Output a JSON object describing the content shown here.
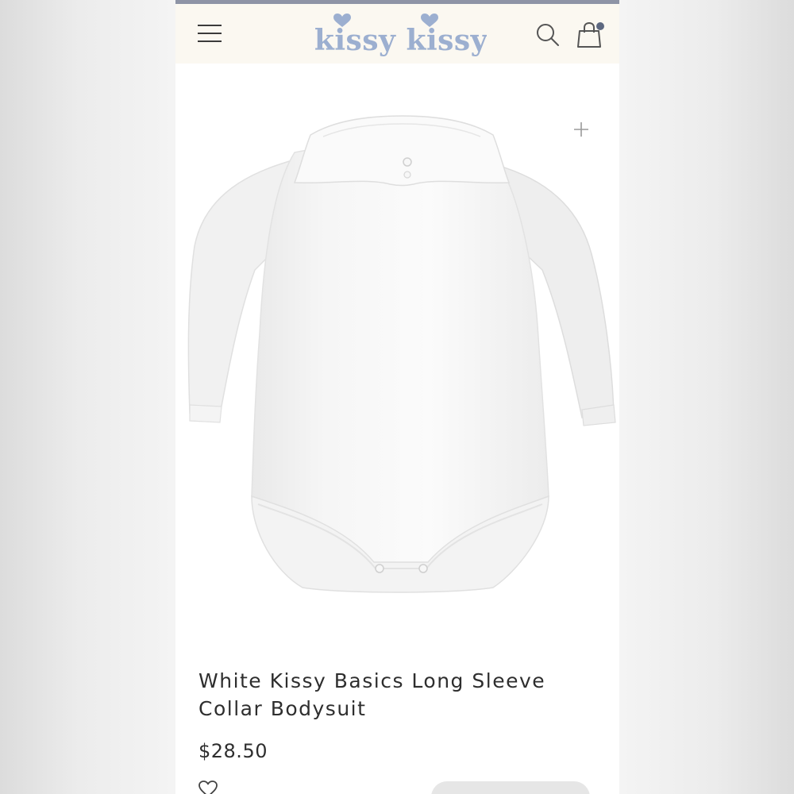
{
  "header": {
    "brand": "kissy kissy",
    "menu_icon": "hamburger-menu-icon",
    "search_icon": "search-icon",
    "bag_icon": "shopping-bag-icon",
    "bag_badge_color": "#5d6880",
    "logo_color": "#9cafd0",
    "background": "#fbf8f1"
  },
  "product": {
    "image": "white-collar-bodysuit-photo",
    "zoom_icon": "plus-icon",
    "title": "White Kissy Basics Long Sleeve Collar Bodysuit",
    "price": "$28.50",
    "wishlist_icon": "heart-outline-icon"
  }
}
